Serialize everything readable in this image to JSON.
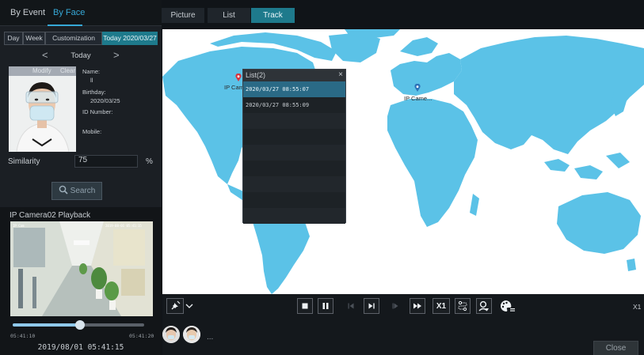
{
  "search_tabs": [
    {
      "label": "By Event"
    },
    {
      "label": "By Face"
    }
  ],
  "range_buttons": [
    {
      "label": "Day"
    },
    {
      "label": "Week"
    },
    {
      "label": "Customization"
    },
    {
      "label": "Today 2020/03/27"
    }
  ],
  "date_nav": {
    "prev": "<",
    "label": "Today",
    "next": ">"
  },
  "photo_bar": {
    "modify": "Modify",
    "clear": "Clear"
  },
  "person": {
    "name_label": "Name:",
    "name_value": "ll",
    "birthday_label": "Birthday:",
    "birthday_value": "2020/03/25",
    "id_label": "ID Number:",
    "mobile_label": "Mobile:"
  },
  "similarity": {
    "label": "Similarity",
    "value": "75",
    "unit": "%"
  },
  "search_button": "Search",
  "playback": {
    "title": "IP Camera02 Playback",
    "seek_progress": 0.51,
    "start_time": "05:41:10",
    "end_time": "05:41:20",
    "timestamp": "2019/08/01 05:41:15"
  },
  "view_tabs": [
    {
      "label": "Picture"
    },
    {
      "label": "List"
    },
    {
      "label": "Track"
    }
  ],
  "map_pins": [
    {
      "label": "IP Cam"
    },
    {
      "label": "IP Came..."
    }
  ],
  "list_popup": {
    "title": "List(2)",
    "close": "×",
    "rows": [
      "2020/03/27 08:55:07",
      "2020/03/27 08:55:09",
      "",
      "",
      "",
      "",
      "",
      "",
      ""
    ]
  },
  "controls": {
    "speed": "X1",
    "right_speed": "X1"
  },
  "thumbs_more": "...",
  "close_button": "Close",
  "colors": {
    "accent": "#1e7a8c",
    "map_land": "#5bc2e7",
    "highlight_row": "#2a6a86"
  }
}
